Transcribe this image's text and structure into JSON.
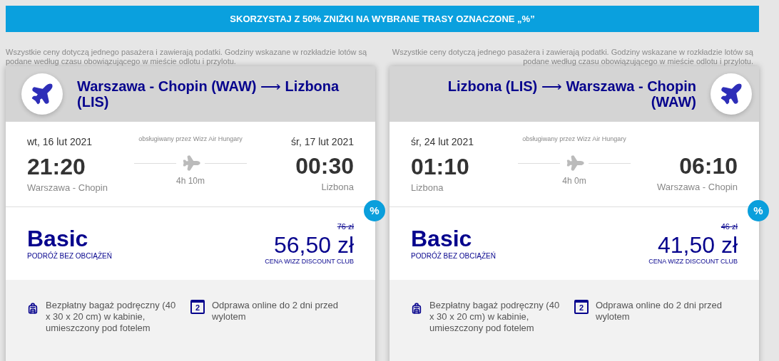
{
  "banner": "SKORZYSTAJ Z 50% ZNIŻKI NA WYBRANE TRASY OZNACZONE „%”",
  "flights": [
    {
      "kind": "outbound",
      "note": "Wszystkie ceny dotyczą jednego pasażera i zawierają podatki. Godziny wskazane w rozkładzie lotów są podane według czasu obowiązującego w mieście odlotu i przylotu.",
      "origin": "Warszawa - Chopin (WAW)",
      "arrow": "⟶",
      "destination": "Lizbona (LIS)",
      "departure_date": "wt, 16 lut 2021",
      "operator": "obsługiwany przez Wizz Air Hungary",
      "arrival_date": "śr, 17 lut 2021",
      "departure_time": "21:20",
      "arrival_time": "00:30",
      "departure_city": "Warszawa - Chopin",
      "duration": "4h 10m",
      "arrival_city": "Lizbona",
      "discount_badge": "%",
      "fare": "Basic",
      "fare_subtitle": "PODRÓŻ BEZ OBCIĄŻEŃ",
      "old_price": "76 zł",
      "price": "56,50 zł",
      "price_label": "CENA WIZZ DISCOUNT CLUB",
      "features": [
        {
          "kind": "bag",
          "text": "Bezpłatny bagaż podręczny (40 x 30 x 20 cm) w kabinie, umieszczony pod fotelem"
        },
        {
          "kind": "calendar",
          "day": "2",
          "text": "Odprawa online do 2 dni przed wylotem"
        }
      ]
    },
    {
      "kind": "return",
      "note": "Wszystkie ceny dotyczą jednego pasażera i zawierają podatki. Godziny wskazane w rozkładzie lotów są podane według czasu obowiązującego w mieście odlotu i przylotu.",
      "origin": "Lizbona (LIS)",
      "arrow": "⟶",
      "destination": "Warszawa - Chopin (WAW)",
      "departure_date": "śr, 24 lut 2021",
      "operator": "obsługiwany przez Wizz Air Hungary",
      "departure_time": "01:10",
      "arrival_time": "06:10",
      "departure_city": "Lizbona",
      "duration": "4h 0m",
      "arrival_city": "Warszawa - Chopin",
      "discount_badge": "%",
      "fare": "Basic",
      "fare_subtitle": "PODRÓŻ BEZ OBCIĄŻEŃ",
      "old_price": "46 zł",
      "price": "41,50 zł",
      "price_label": "CENA WIZZ DISCOUNT CLUB",
      "features": [
        {
          "kind": "bag",
          "text": "Bezpłatny bagaż podręczny (40 x 30 x 20 cm) w kabinie, umieszczony pod fotelem"
        },
        {
          "kind": "calendar",
          "day": "2",
          "text": "Odprawa online do 2 dni przed wylotem"
        }
      ]
    }
  ]
}
